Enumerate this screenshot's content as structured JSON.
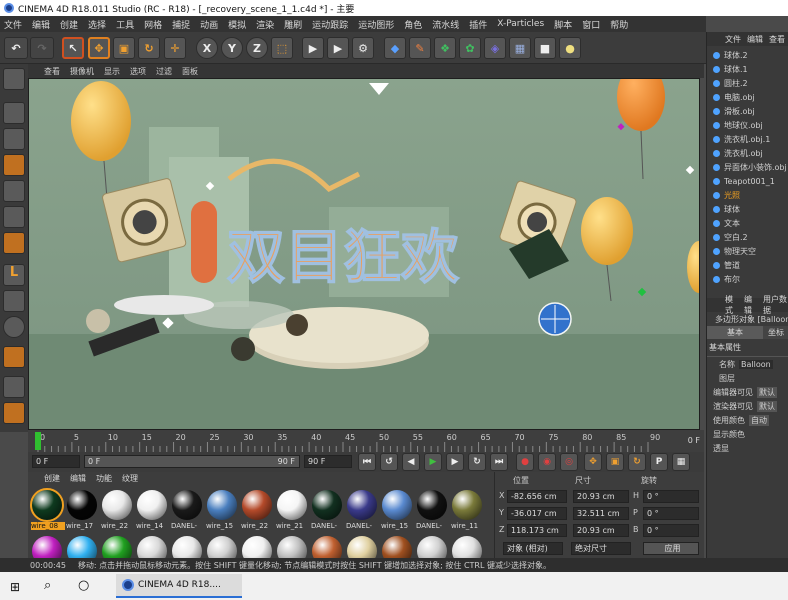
{
  "window": {
    "title": "CINEMA 4D R18.011 Studio (RC - R18) - [_recovery_scene_1_1.c4d *] - 主要"
  },
  "menu": [
    "文件",
    "编辑",
    "创建",
    "选择",
    "工具",
    "网格",
    "捕捉",
    "动画",
    "模拟",
    "渲染",
    "雕刷",
    "运动跟踪",
    "运动图形",
    "角色",
    "流水线",
    "插件",
    "X-Particles",
    "脚本",
    "窗口",
    "帮助"
  ],
  "viewport_menu": [
    "查看",
    "摄像机",
    "显示",
    "选项",
    "过滤",
    "面板"
  ],
  "scene_text": "双目狂欢",
  "timeline": {
    "ticks": [
      "0",
      "5",
      "10",
      "15",
      "20",
      "25",
      "30",
      "35",
      "40",
      "45",
      "50",
      "55",
      "60",
      "65",
      "70",
      "75",
      "80",
      "85",
      "90"
    ],
    "end": "0 F"
  },
  "transport": {
    "start": "0 F",
    "current": "0 F",
    "range_start": "0 F",
    "range_end": "90 F",
    "end": "90 F"
  },
  "materials": {
    "menu": [
      "创建",
      "编辑",
      "功能",
      "纹理"
    ],
    "items": [
      {
        "name": "wire_08",
        "color": "#0e3a1f"
      },
      {
        "name": "wire_17",
        "color": "#050505"
      },
      {
        "name": "wire_22",
        "color": "#e8e8e8"
      },
      {
        "name": "wire_14",
        "color": "#f0f0f0"
      },
      {
        "name": "DANEL-",
        "color": "#1a1a1a"
      },
      {
        "name": "wire_15",
        "color": "#4a7fbf"
      },
      {
        "name": "wire_22",
        "color": "#b44a2a"
      },
      {
        "name": "wire_21",
        "color": "#f5f5f5"
      },
      {
        "name": "DANEL-",
        "color": "#123020"
      },
      {
        "name": "DANEL-",
        "color": "#3a3a8a"
      },
      {
        "name": "wire_15",
        "color": "#5a8ad0"
      },
      {
        "name": "DANEL-",
        "color": "#111111"
      },
      {
        "name": "wire_11",
        "color": "#7a7a3a"
      }
    ],
    "row2_colors": [
      "#c020c0",
      "#30b0f0",
      "#20a020",
      "#d8d8d8",
      "#e8e8e8",
      "#cfcfcf",
      "#f0f0f0",
      "#c0c0c0",
      "#c06030",
      "#e0d0a0",
      "#a05020",
      "#d0d0d0",
      "#e0e0e0"
    ]
  },
  "coords": {
    "headers": [
      "位置",
      "尺寸",
      "旋转"
    ],
    "rows": [
      {
        "axis": "X",
        "pos": "-82.656 cm",
        "size": "20.93 cm",
        "rot_label": "H",
        "rot": "0 °"
      },
      {
        "axis": "Y",
        "pos": "-36.017 cm",
        "size": "32.511 cm",
        "rot_label": "P",
        "rot": "0 °"
      },
      {
        "axis": "Z",
        "pos": "118.173 cm",
        "size": "20.93 cm",
        "rot_label": "B",
        "rot": "0 °"
      }
    ],
    "mode1": "对象 (相对)",
    "mode2": "绝对尺寸",
    "apply": "应用"
  },
  "status": {
    "time": "00:00:45",
    "message": "移动: 点击并拖动鼠标移动元素。按住 SHIFT 键量化移动; 节点编辑模式时按住 SHIFT 键增加选择对象; 按住 CTRL 键减少选择对象。"
  },
  "objects": {
    "tabs": [
      "文件",
      "编辑",
      "查看"
    ],
    "items": [
      "球体.2",
      "球体.1",
      "圆柱.2",
      "电脑.obj",
      "滑板.obj",
      "地球仪.obj",
      "洗衣机.obj.1",
      "洗衣机.obj",
      "异面体小装饰.obj",
      "Teapot001_1",
      "光照",
      "球体",
      "文本",
      "空白.2",
      "物理天空",
      "管道",
      "布尔"
    ],
    "highlight_index": 10
  },
  "attributes": {
    "tabs": [
      "模式",
      "编辑",
      "用户数据"
    ],
    "object_label": "多边形对象 [Balloon]",
    "tab_basic": "基本",
    "tab_coord": "坐标",
    "section": "基本属性",
    "name_label": "名称",
    "name_value": "Balloon",
    "layer_label": "图层",
    "rows": [
      {
        "label": "编辑器可见",
        "value": "默认"
      },
      {
        "label": "渲染器可见",
        "value": "默认"
      },
      {
        "label": "使用颜色",
        "value": "自动"
      },
      {
        "label": "显示颜色",
        "value": ""
      },
      {
        "label": "透显",
        "value": ""
      }
    ]
  },
  "taskbar": {
    "app": "CINEMA 4D R18...."
  },
  "colors": {
    "accent": "#2a6ed4",
    "viewport_bg": "#8fa892",
    "balloon": "#f0b040"
  }
}
